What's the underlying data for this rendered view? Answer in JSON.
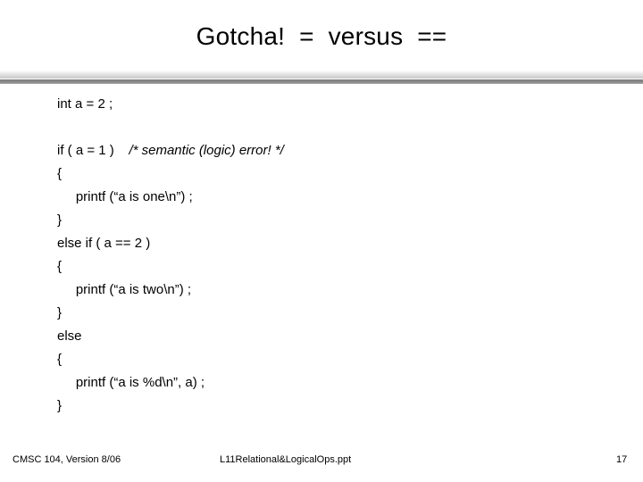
{
  "slide": {
    "title": "Gotcha!  =  versus  ==",
    "code_lines": [
      {
        "text": "int a = 2 ;",
        "comment": ""
      },
      {
        "text": "",
        "comment": ""
      },
      {
        "text": "if ( a = 1 )    ",
        "comment": "/* semantic (logic) error! */"
      },
      {
        "text": "{",
        "comment": ""
      },
      {
        "text": "     printf (“a is one\\n”) ;",
        "comment": ""
      },
      {
        "text": "}",
        "comment": ""
      },
      {
        "text": "else if ( a == 2 )",
        "comment": ""
      },
      {
        "text": "{",
        "comment": ""
      },
      {
        "text": "     printf (“a is two\\n”) ;",
        "comment": ""
      },
      {
        "text": "}",
        "comment": ""
      },
      {
        "text": "else",
        "comment": ""
      },
      {
        "text": "{",
        "comment": ""
      },
      {
        "text": "     printf (“a is %d\\n”, a) ;",
        "comment": ""
      },
      {
        "text": "}",
        "comment": ""
      }
    ]
  },
  "footer": {
    "left": "CMSC 104, Version 8/06",
    "center": "L11Relational&LogicalOps.ppt",
    "page_number": "17"
  },
  "colors": {
    "text": "#000000",
    "background": "#ffffff",
    "divider_light": "#c9c9c9",
    "divider_dark": "#7d7d7d"
  }
}
